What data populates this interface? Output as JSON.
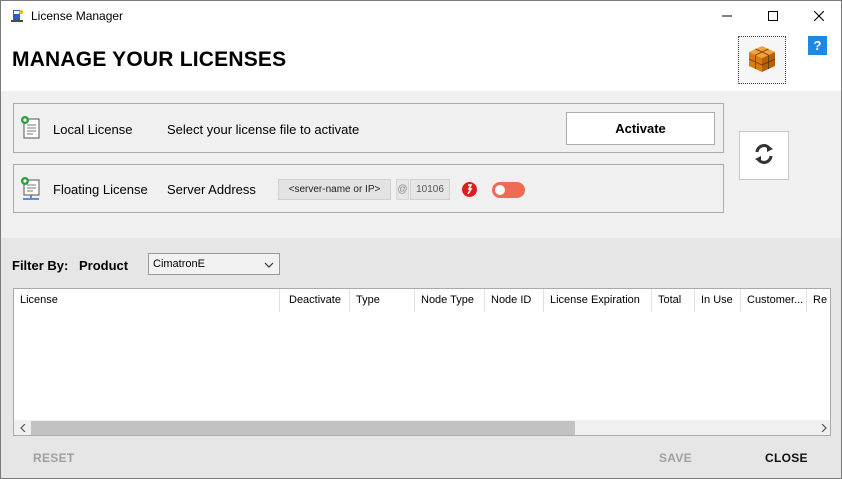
{
  "window": {
    "title": "License Manager"
  },
  "header": {
    "title": "MANAGE YOUR LICENSES",
    "help_label": "?"
  },
  "local_license": {
    "label": "Local License",
    "description": "Select your license file to activate",
    "activate_label": "Activate"
  },
  "floating_license": {
    "label": "Floating License",
    "server_label": "Server Address",
    "server_placeholder": "<server-name or IP>",
    "at_symbol": "@",
    "port": "10106"
  },
  "filter": {
    "label": "Filter By:",
    "product_label": "Product",
    "product_value": "CimatronE"
  },
  "table": {
    "columns": [
      "License",
      "Deactivate",
      "Type",
      "Node Type",
      "Node ID",
      "License Expiration",
      "Total",
      "In Use",
      "Customer...",
      "Re"
    ]
  },
  "footer": {
    "reset_label": "RESET",
    "save_label": "SAVE",
    "close_label": "CLOSE"
  },
  "colors": {
    "help_blue": "#1e88e5",
    "toggle_off": "#ef6b55",
    "status_red": "#d9201c",
    "panel_bg": "#f0f0f0",
    "filter_bg": "#e6e6e6"
  },
  "icons": {
    "app": "license-manager-app-icon",
    "package": "package-cube-icon",
    "refresh": "refresh-icon",
    "local": "certificate-icon",
    "floating": "network-certificate-icon",
    "status": "disconnected-icon"
  }
}
